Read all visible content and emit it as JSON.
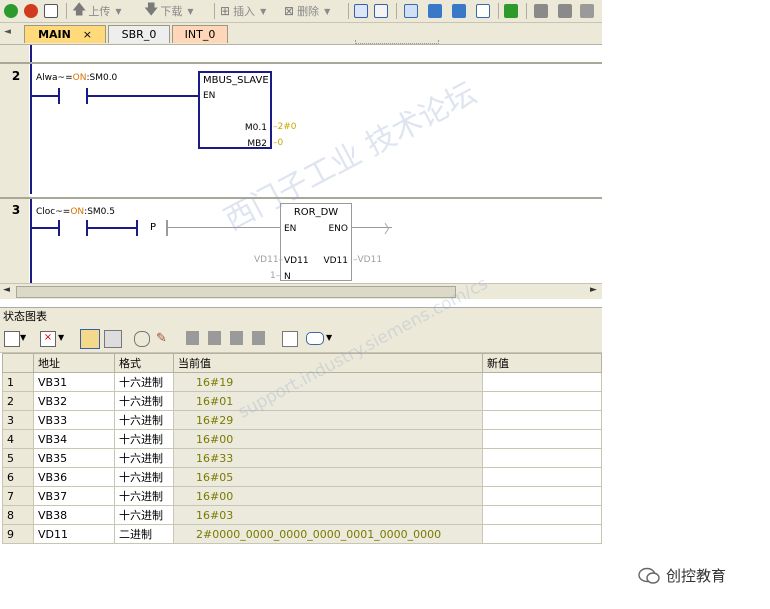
{
  "toolbar": {
    "upload_label": "上传",
    "download_label": "下载",
    "insert_label": "插入",
    "delete_label": "删除"
  },
  "tabs": [
    {
      "label": "MAIN",
      "close": "×"
    },
    {
      "label": "SBR_0"
    },
    {
      "label": "INT_0"
    }
  ],
  "networks": [
    {
      "number": "2",
      "contact_label_prefix": "Alwa~=",
      "contact_label_state": "ON",
      "contact_label_addr": ":SM0.0",
      "block_name": "MBUS_SLAVE",
      "pin_en": "EN",
      "pin1_name": "M0.1",
      "pin1_value": "2#0",
      "pin2_name": "MB2",
      "pin2_value": "0"
    },
    {
      "number": "3",
      "contact_label_prefix": "Cloc~=",
      "contact_label_state": "ON",
      "contact_label_addr": ":SM0.5",
      "edge_label": "P",
      "block_name": "ROR_DW",
      "pin_en": "EN",
      "pin_eno": "ENO",
      "in_addr": "VD11",
      "in_pin": "VD11",
      "out_pin": "VD11",
      "out_addr": "VD11",
      "n_value": "1",
      "n_pin": "N"
    }
  ],
  "status_chart": {
    "title": "状态图表",
    "columns": {
      "address": "地址",
      "format": "格式",
      "current": "当前值",
      "new": "新值"
    },
    "rows": [
      {
        "n": "1",
        "address": "VB31",
        "format": "十六进制",
        "value": "16#19"
      },
      {
        "n": "2",
        "address": "VB32",
        "format": "十六进制",
        "value": "16#01"
      },
      {
        "n": "3",
        "address": "VB33",
        "format": "十六进制",
        "value": "16#29"
      },
      {
        "n": "4",
        "address": "VB34",
        "format": "十六进制",
        "value": "16#00"
      },
      {
        "n": "5",
        "address": "VB35",
        "format": "十六进制",
        "value": "16#33"
      },
      {
        "n": "6",
        "address": "VB36",
        "format": "十六进制",
        "value": "16#05"
      },
      {
        "n": "7",
        "address": "VB37",
        "format": "十六进制",
        "value": "16#00"
      },
      {
        "n": "8",
        "address": "VB38",
        "format": "十六进制",
        "value": "16#03"
      },
      {
        "n": "9",
        "address": "VD11",
        "format": "二进制",
        "value": "2#0000_0000_0000_0000_0001_0000_0000"
      }
    ]
  },
  "watermark": {
    "line1": "西门子工业 技术论坛",
    "line2": "support.industry.siemens.com/cs"
  },
  "brand": {
    "name": "创控教育"
  }
}
